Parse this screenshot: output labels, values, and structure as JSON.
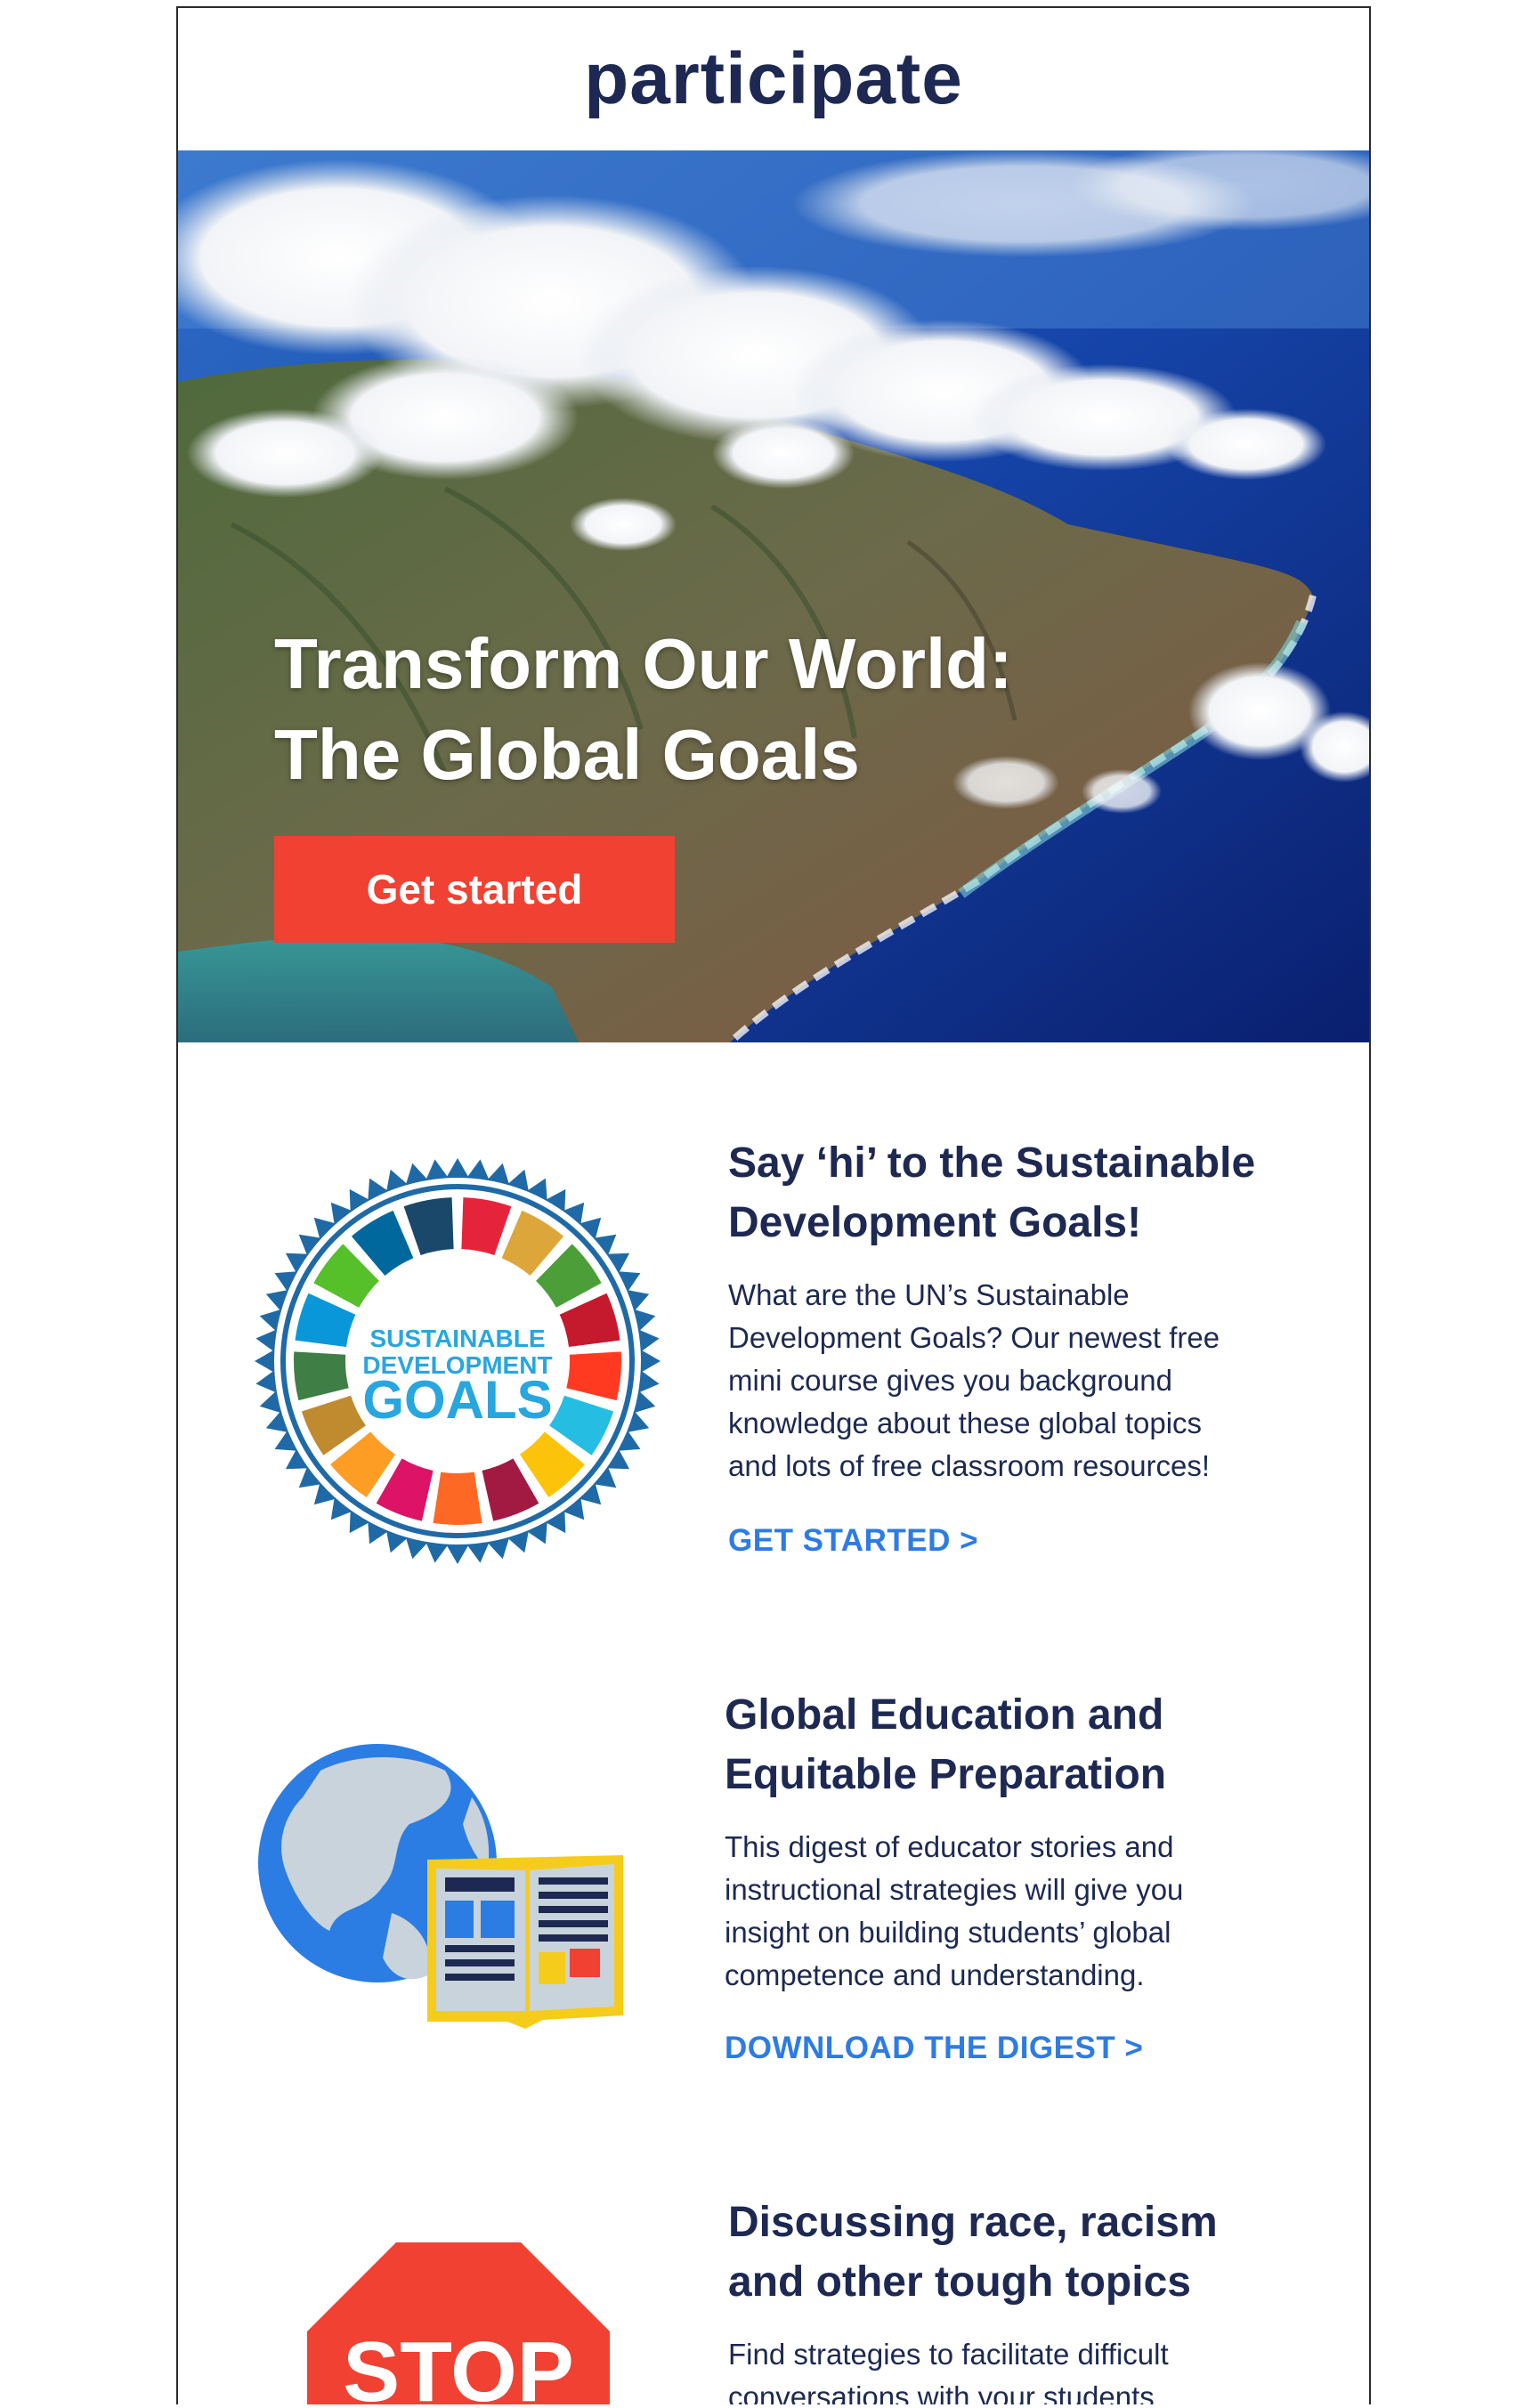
{
  "header": {
    "logo_text": "participate"
  },
  "hero": {
    "title_line1": "Transform Our World:",
    "title_line2": "The Global Goals",
    "cta_label": "Get started"
  },
  "sections": [
    {
      "title_line1": "Say ‘hi’ to the Sustainable",
      "title_line2": "Development Goals!",
      "body": [
        "What are the UN’s Sustainable",
        "Development Goals? Our newest free",
        "mini course gives you background",
        "knowledge about these global topics",
        "and lots of free classroom resources!"
      ],
      "link": "GET STARTED >",
      "badge_line1": "SUSTAINABLE",
      "badge_line2": "DEVELOPMENT",
      "badge_line3": "GOALS"
    },
    {
      "title_line1": "Global Education and",
      "title_line2": "Equitable Preparation",
      "body": [
        "This digest of educator stories and",
        "instructional strategies will give you",
        "insight on building students’ global",
        "competence and understanding."
      ],
      "link": "DOWNLOAD THE DIGEST >"
    },
    {
      "title_line1": "Discussing race, racism",
      "title_line2": "and other tough topics",
      "body": [
        "Find strategies to facilitate difficult",
        "conversations with your students"
      ],
      "stop_sign_text": "STOP"
    }
  ],
  "colors": {
    "navy": "#1d2952",
    "link_blue": "#2d7be5",
    "cta_red": "#f04132"
  },
  "icons": [
    "sdg-wheel-icon",
    "globe-book-icon",
    "stop-sign-icon"
  ]
}
